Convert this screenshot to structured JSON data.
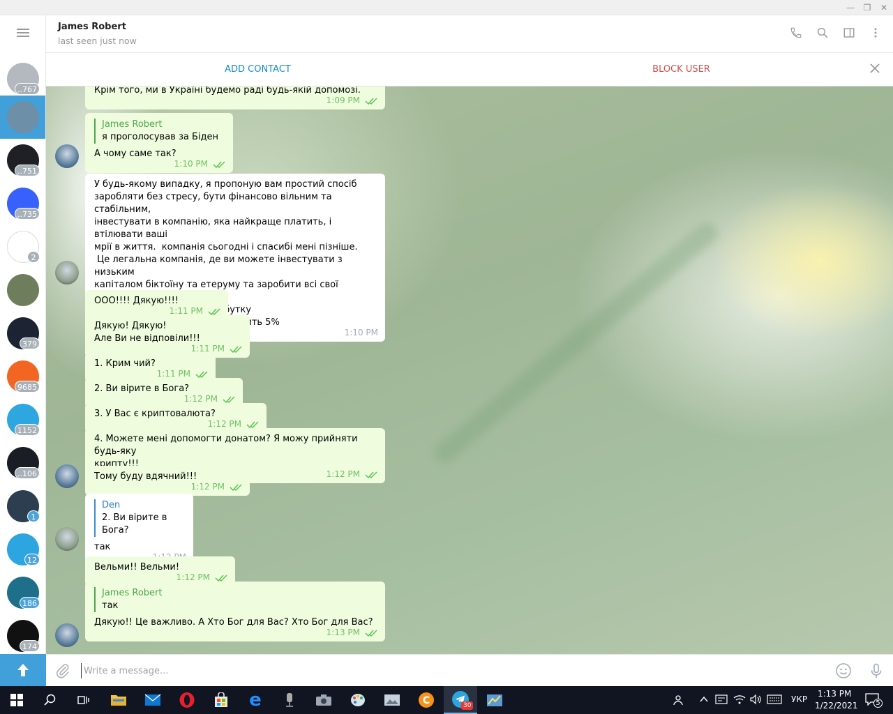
{
  "window": {
    "minimize": "—",
    "restore": "❐",
    "close": "✕"
  },
  "rail": {
    "menu_label": "Menu",
    "chats": [
      {
        "name": "archive",
        "badge": "..767",
        "color": "#b3b9bf",
        "active": false
      },
      {
        "name": "james-robert",
        "badge": "",
        "color": "#6d8fa8",
        "active": true
      },
      {
        "name": "binance",
        "badge": "..751",
        "color": "#1e2026",
        "active": false
      },
      {
        "name": "coinmarketcap",
        "badge": "..735",
        "color": "#3861fb",
        "active": false
      },
      {
        "name": "bitcoin-b",
        "badge": "2",
        "color": "#ffffff",
        "active": false
      },
      {
        "name": "mountain-man",
        "badge": "",
        "color": "#6e7e5d",
        "active": false
      },
      {
        "name": "blue-squares",
        "badge": "379",
        "color": "#1c2333",
        "active": false
      },
      {
        "name": "orange-rocket",
        "badge": "9685",
        "color": "#f26522",
        "active": false
      },
      {
        "name": "blue-g",
        "badge": "1152",
        "color": "#2ea7e0",
        "active": false
      },
      {
        "name": "chart-dark",
        "badge": "..106",
        "color": "#1a1d24",
        "active": false
      },
      {
        "name": "coins",
        "badge": "1",
        "badge_blue": true,
        "color": "#2c3e50",
        "active": false
      },
      {
        "name": "telegram",
        "badge": "12",
        "badge_blue": true,
        "color": "#2ca5e0",
        "active": false
      },
      {
        "name": "pro-blockchain",
        "badge": "186",
        "badge_blue": true,
        "color": "#1d6f8a",
        "active": false
      },
      {
        "name": "battle-of-traders",
        "badge": "174",
        "color": "#111111",
        "active": false
      }
    ]
  },
  "header": {
    "peer_name": "James Robert",
    "peer_status": "last seen just now",
    "phone_icon": "phone-icon",
    "search_icon": "search-icon",
    "sidebar_icon": "sidebar-icon",
    "more_icon": "more-icon"
  },
  "actionbar": {
    "add_contact": "ADD CONTACT",
    "block_user": "BLOCK USER"
  },
  "messages": [
    {
      "dir": "out",
      "text": "Крім того, ми в Україні будемо раді будь-якій допомозі.",
      "time": "1:09 PM"
    },
    {
      "dir": "out",
      "reply_name": "James Robert",
      "reply_text": "я проголосував за Біден",
      "text": "А чому саме так?",
      "time": "1:10 PM"
    },
    {
      "dir": "in",
      "text": "У будь-якому випадку, я пропоную вам простий спосіб\nзаробляти без стресу, бути фінансово вільним та стабільним,\nінвестувати в компанію, яка найкраще платить, і втілювати ваші\nмрії в життя.  компанія сьогодні і спасибі мені пізніше.\n Це легальна компанія, де ви можете інвестувати з низьким\nкапіталом біктоїну та етеруму та заробити всі свої інвестиції\nчерез 24 години з 20% прибутку\n Комісія за направлення становить 5%",
      "time": "1:10 PM"
    },
    {
      "dir": "out",
      "text": "ООО!!!! Дякую!!!!",
      "time": "1:11 PM"
    },
    {
      "dir": "out",
      "text": "Дякую! Дякую!\nАле Ви не відповіли!!!",
      "time": "1:11 PM"
    },
    {
      "dir": "out",
      "text": "1. Крим чий?",
      "time": "1:11 PM"
    },
    {
      "dir": "out",
      "text": "2. Ви вірите в Бога?",
      "time": "1:12 PM"
    },
    {
      "dir": "out",
      "text": "3. У Вас є криптовалюта?",
      "time": "1:12 PM"
    },
    {
      "dir": "out",
      "text": "4. Можете мені допомогти донатом? Я можу прийняти будь-яку\nкрипту!!!",
      "time": "1:12 PM"
    },
    {
      "dir": "out",
      "text": "Тому буду вдячний!!!",
      "time": "1:12 PM"
    },
    {
      "dir": "in",
      "reply_name": "Den",
      "reply_text": "2. Ви вірите в Бога?",
      "text": "так",
      "time": "1:12 PM"
    },
    {
      "dir": "out",
      "text": "Вельми!! Вельми!",
      "time": "1:12 PM"
    },
    {
      "dir": "out",
      "reply_name": "James Robert",
      "reply_text": "так",
      "text": "Дякую!! Це важливо. А Хто Бог для Вас? Хто Бог для Вас?",
      "time": "1:13 PM"
    }
  ],
  "composer": {
    "placeholder": "Write a message...",
    "attach_icon": "paperclip-icon",
    "emoji_icon": "emoji-icon",
    "mic_icon": "microphone-icon"
  },
  "taskbar": {
    "language": "УКР",
    "time": "1:13 PM",
    "date": "1/22/2021",
    "notifications": "5",
    "telegram_badge": "30"
  }
}
